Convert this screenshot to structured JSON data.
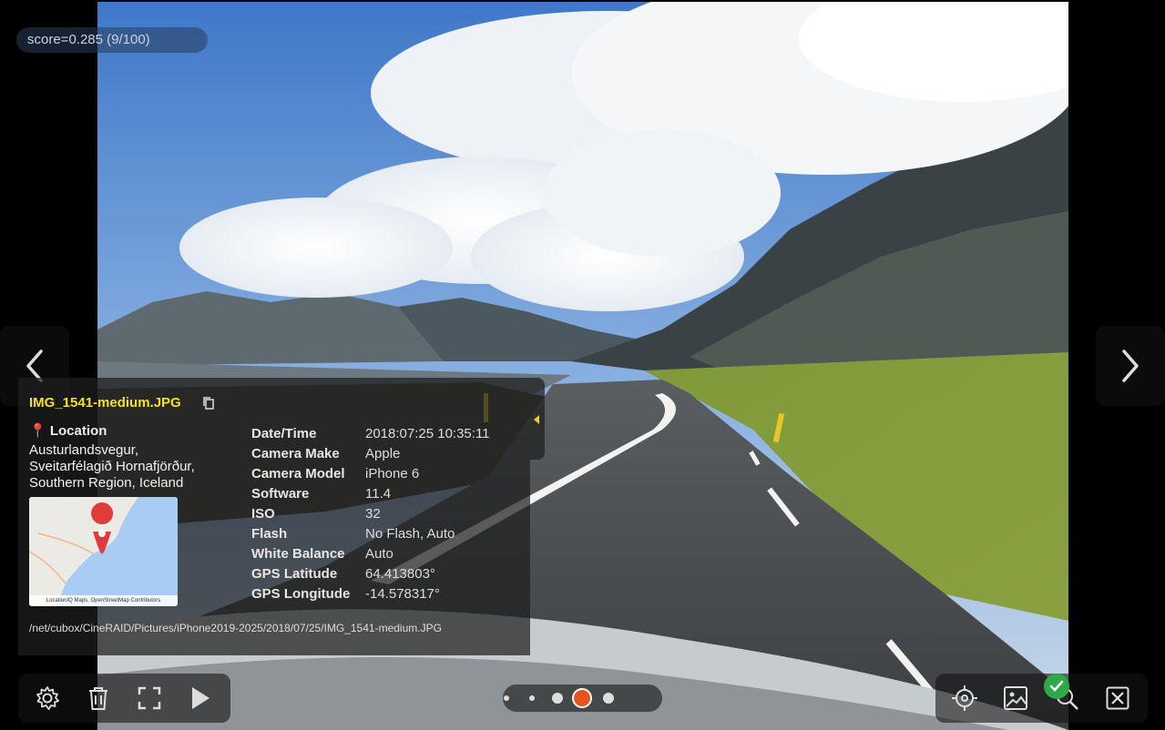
{
  "score": {
    "label": "score=0.285 (9/100)"
  },
  "nav": {
    "prev_icon": "chevron-left-icon",
    "next_icon": "chevron-right-icon"
  },
  "info": {
    "filename": "IMG_1541-medium.JPG",
    "location_pin": "📍",
    "location_title": "Location",
    "address": [
      "Austurlandsvegur,",
      "Sveitarfélagið Hornafjörður,",
      "Southern Region, Iceland"
    ],
    "map_attribution": "LocationIQ Maps, OpenStreetMap Contributors",
    "exif": [
      {
        "key": "Date/Time",
        "value": "2018:07:25 10:35:11"
      },
      {
        "key": "Camera Make",
        "value": "Apple"
      },
      {
        "key": "Camera Model",
        "value": "iPhone 6"
      },
      {
        "key": "Software",
        "value": "11.4"
      },
      {
        "key": "ISO",
        "value": "32"
      },
      {
        "key": "Flash",
        "value": "No Flash, Auto"
      },
      {
        "key": "White Balance",
        "value": "Auto"
      },
      {
        "key": "GPS Latitude",
        "value": "64.413803°"
      },
      {
        "key": "GPS Longitude",
        "value": "-14.578317°"
      }
    ],
    "path": "/net/cubox/CineRAID/Pictures/iPhone2019-2025/2018/07/25/IMG_1541-medium.JPG"
  },
  "toolbar_left": [
    "gear-icon",
    "trash-icon",
    "fullscreen-icon",
    "play-icon"
  ],
  "toolbar_right": [
    "crosshair-icon",
    "image-icon",
    "search-icon",
    "close-box-icon"
  ],
  "colors": {
    "filename": "#f5e020",
    "active_dot": "#e8521f",
    "check": "#2faa4a"
  }
}
